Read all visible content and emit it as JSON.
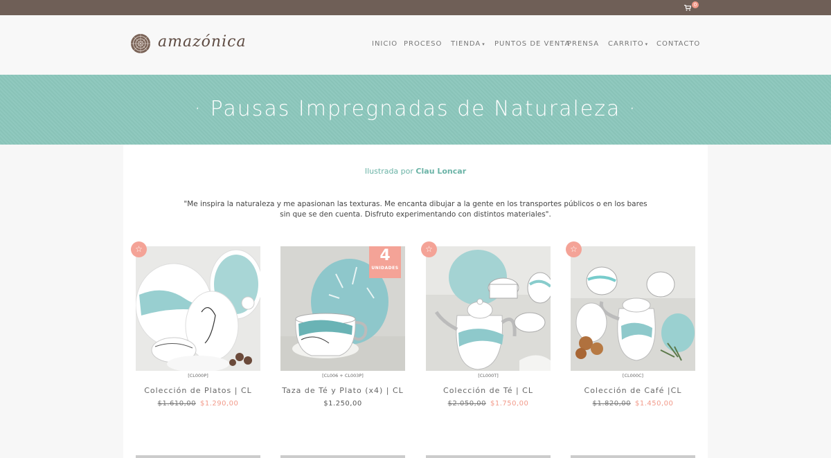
{
  "topbar": {
    "cart_count": "0",
    "cart_icon": "cart-icon"
  },
  "brand": {
    "logo_text": "amazónica",
    "logo_icon": "tree-ring-logo-icon"
  },
  "nav": {
    "items": [
      "INICIO",
      "PROCESO",
      "TIENDA",
      "PUNTOS DE VENTA",
      "PRENSA",
      "CARRITO",
      "CONTACTO"
    ],
    "caret": "▾"
  },
  "banner": {
    "title": "· Pausas Impregnadas de Naturaleza ·"
  },
  "intro": {
    "illustrated_prefix": "Ilustrada por",
    "illustrator": "Clau Loncar",
    "quote": "\"Me inspira la naturaleza y me apasionan las texturas. Me encanta dibujar a la gente en los transportes públicos o en los bares sin que se den cuenta. Disfruto experimentando con distintos materiales\"."
  },
  "products": [
    {
      "sku": "[CL000P]",
      "name": "Colección de Platos | CL",
      "old_price": "$1.610,00",
      "price": "$1.290,00",
      "badge": "star-icon"
    },
    {
      "sku": "[CL006 + CL003P]",
      "name": "Taza de Té y Plato (x4) | CL",
      "old_price": "",
      "price": "$1.250,00",
      "units_number": "4",
      "units_label": "UNIDADES"
    },
    {
      "sku": "[CL000T]",
      "name": "Colección de Té | CL",
      "old_price": "$2.050,00",
      "price": "$1.750,00",
      "badge": "star-icon"
    },
    {
      "sku": "[CL000C]",
      "name": "Colección de Café |CL",
      "old_price": "$1.820,00",
      "price": "$1.450,00",
      "badge": "star-icon"
    }
  ],
  "colors": {
    "topbar": "#6f5f57",
    "banner": "#8cc7bc",
    "accent": "#f4a397",
    "link": "#6ab3a6"
  }
}
